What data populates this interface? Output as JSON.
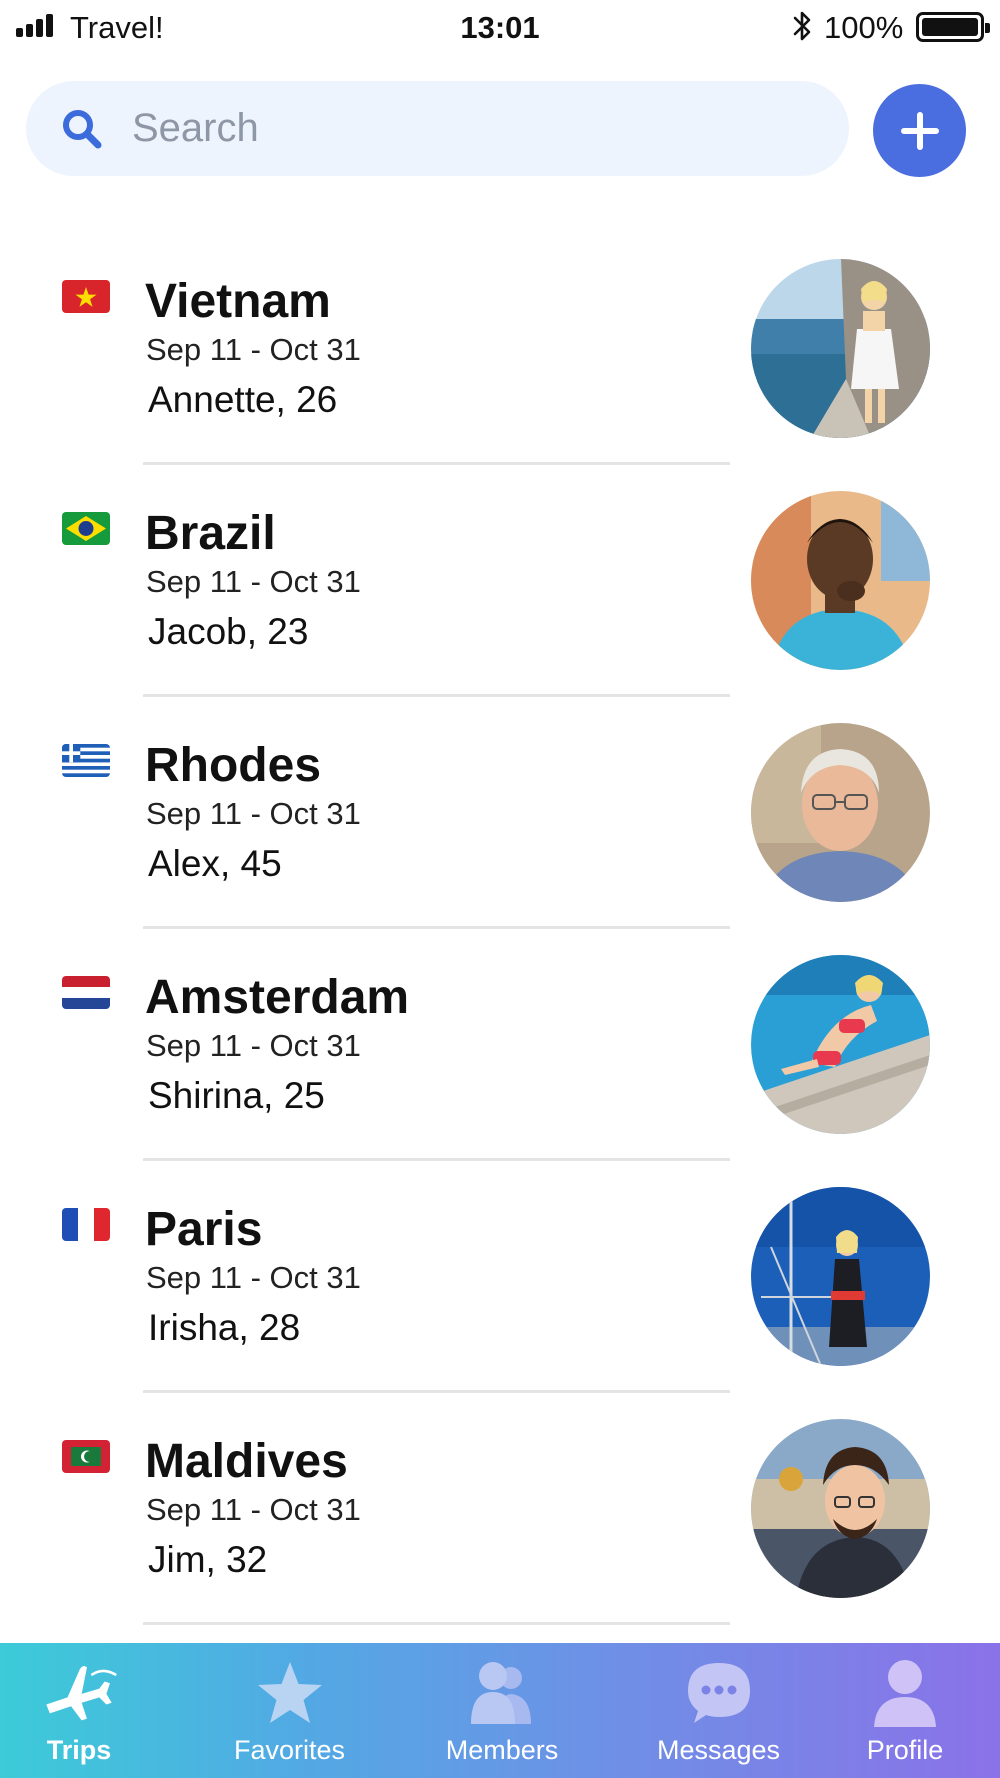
{
  "status_bar": {
    "carrier": "Travel!",
    "time": "13:01",
    "battery": "100%"
  },
  "search": {
    "placeholder": "Search"
  },
  "trips": [
    {
      "destination": "Vietnam",
      "dates": "Sep 11 - Oct 31",
      "traveler": "Annette, 26",
      "flag": "vietnam-flag-icon"
    },
    {
      "destination": "Brazil",
      "dates": "Sep 11 - Oct 31",
      "traveler": "Jacob, 23",
      "flag": "brazil-flag-icon"
    },
    {
      "destination": "Rhodes",
      "dates": "Sep 11 - Oct 31",
      "traveler": "Alex, 45",
      "flag": "greece-flag-icon"
    },
    {
      "destination": "Amsterdam",
      "dates": "Sep 11 - Oct 31",
      "traveler": "Shirina, 25",
      "flag": "netherlands-flag-icon"
    },
    {
      "destination": "Paris",
      "dates": "Sep 11 - Oct 31",
      "traveler": "Irisha, 28",
      "flag": "france-flag-icon"
    },
    {
      "destination": "Maldives",
      "dates": "Sep 11 - Oct 31",
      "traveler": "Jim, 32",
      "flag": "maldives-flag-icon"
    }
  ],
  "tab_bar": {
    "tabs": [
      {
        "label": "Trips",
        "icon": "airplane-icon",
        "active": true
      },
      {
        "label": "Favorites",
        "icon": "star-icon",
        "active": false
      },
      {
        "label": "Members",
        "icon": "members-icon",
        "active": false
      },
      {
        "label": "Messages",
        "icon": "chat-bubble-icon",
        "active": false
      },
      {
        "label": "Profile",
        "icon": "person-icon",
        "active": false
      }
    ]
  },
  "colors": {
    "accent": "#4a6ee0",
    "search_bg": "#eef4fd",
    "tab_gradient_start": "#3ccbd8",
    "tab_gradient_end": "#8a72e8"
  }
}
